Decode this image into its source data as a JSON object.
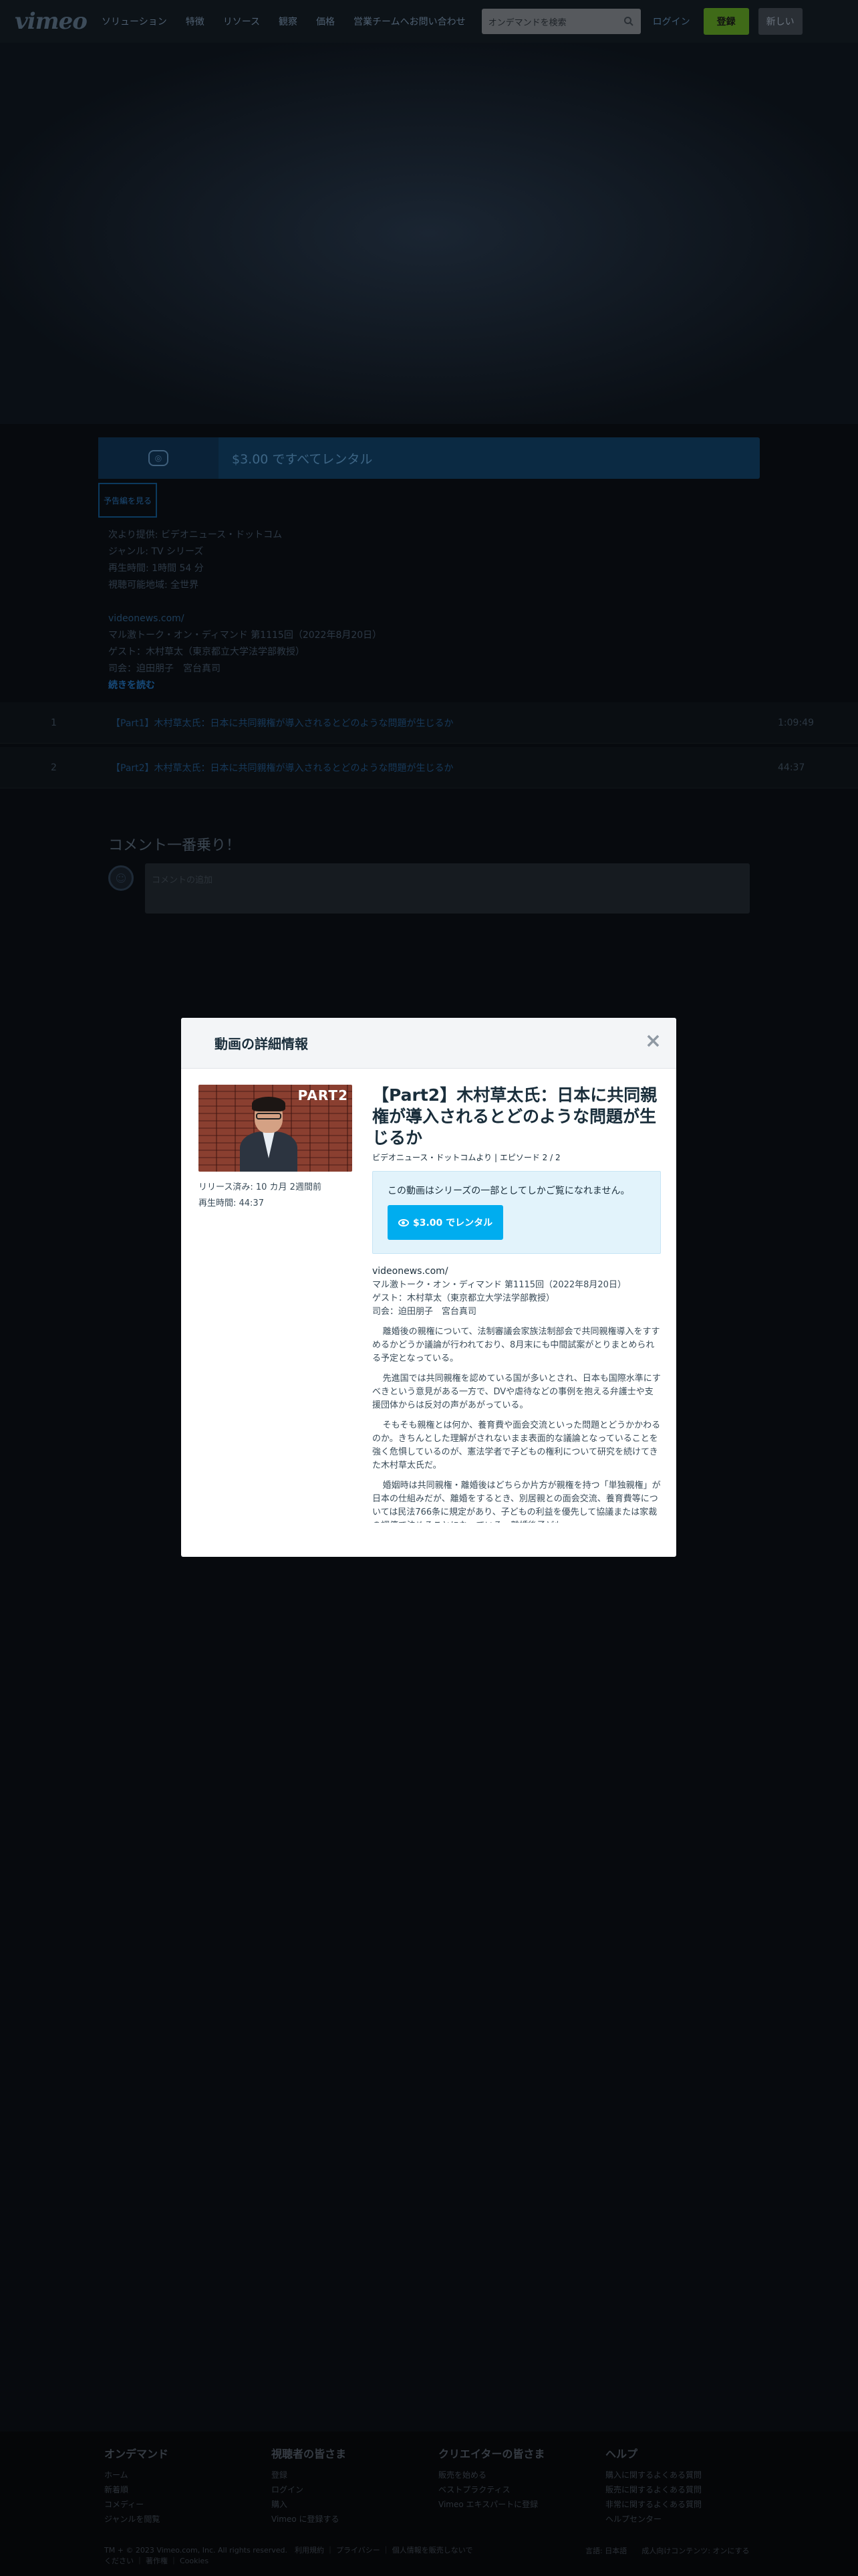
{
  "header": {
    "logo": "vimeo",
    "nav": [
      "ソリューション",
      "特徴",
      "リソース",
      "観察",
      "価格",
      "営業チームへお問い合わせ"
    ],
    "search_placeholder": "オンデマンドを検索",
    "login": "ログイン",
    "join": "登録",
    "new_video": "新しい"
  },
  "rent_bar": {
    "text": "$3.00 ですべてレンタル"
  },
  "series_tag": "予告編を見る",
  "meta": {
    "lines": [
      "次より提供: ビデオニュース・ドットコム",
      "ジャンル: TV シリーズ",
      "再生時間: 1時間 54 分",
      "視聴可能地域: 全世界"
    ],
    "link": "videonews.com/",
    "desc1": "マル激トーク・オン・ディマンド 第1115回（2022年8月20日）",
    "desc2": "ゲスト：木村草太（東京都立大学法学部教授）",
    "desc3": "司会：迫田朋子　宮台真司",
    "read_more": "続きを読む"
  },
  "episodes": [
    {
      "num": "1",
      "title": "【Part1】木村草太氏：日本に共同親権が導入されるとどのような問題が生じるか",
      "duration": "1:09:49"
    },
    {
      "num": "2",
      "title": "【Part2】木村草太氏：日本に共同親権が導入されるとどのような問題が生じるか",
      "duration": "44:37"
    }
  ],
  "comments": {
    "heading": "コメント一番乗り！",
    "placeholder": "コメントの追加"
  },
  "footer": {
    "cols": [
      {
        "title": "オンデマンド",
        "items": [
          "ホーム",
          "新着順",
          "コメディー",
          "ジャンルを閲覧"
        ]
      },
      {
        "title": "視聴者の皆さま",
        "items": [
          "登録",
          "ログイン",
          "購入",
          "Vimeo に登録する"
        ]
      },
      {
        "title": "クリエイターの皆さま",
        "items": [
          "販売を始める",
          "ベストプラクティス",
          "Vimeo エキスパートに登録"
        ]
      },
      {
        "title": "ヘルプ",
        "items": [
          "購入に関するよくある質問",
          "販売に関するよくある質問",
          "非常に関するよくある質問",
          "ヘルプセンター"
        ]
      }
    ],
    "copyright": "TM + © 2023 Vimeo.com, Inc. All rights reserved.　利用規約 ｜ プライバシー ｜ 個人情報を販売しないでください ｜ 著作権 ｜ Cookies",
    "language": "言語: 日本語　　成人向けコンテンツ: オンにする"
  },
  "modal": {
    "title": "動画の詳細情報",
    "close": "×",
    "thumb_badge": "PART2",
    "release": "リリース済み: 10 カ月 2週間前",
    "duration": "再生時間: 44:37",
    "video_title": "【Part2】木村草太氏：日本に共同親権が導入されるとどのような問題が生じるか",
    "crumb": "ビデオニュース・ドットコムより | エピソード 2 / 2",
    "box_text": "この動画はシリーズの一部としてしかご覧になれません。",
    "rent_button": "$3.00 でレンタル",
    "link": "videonews.com/",
    "line1": "マル激トーク・オン・ディマンド 第1115回（2022年8月20日）",
    "line2": "ゲスト：木村草太（東京都立大学法学部教授）",
    "line3": "司会：迫田朋子　宮台真司",
    "para1": "離婚後の親権について、法制審議会家族法制部会で共同親権導入をすすめるかどうか議論が行われており、8月末にも中間試案がとりまとめられる予定となっている。",
    "para2": "先進国では共同親権を認めている国が多いとされ、日本も国際水準にすべきという意見がある一方で、DVや虐待などの事例を抱える弁護士や支援団体からは反対の声があがっている。",
    "para3": "そもそも親権とは何か、養育費や面会交流といった問題とどうかかわるのか。きちんとした理解がされないまま表面的な議論となっていることを強く危惧しているのが、憲法学者で子どもの権利について研究を続けてきた木村草太氏だ。",
    "para4": "婚姻時は共同親権・離婚後はどちらか片方が親権を持つ「単独親権」が日本の仕組みだが、離婚をするとき、別居親との面会交流、養育費等については民法766条に規定があり、子どもの利益を優先して協議または家裁の調停で決めることになっている。離婚後子ども"
  }
}
